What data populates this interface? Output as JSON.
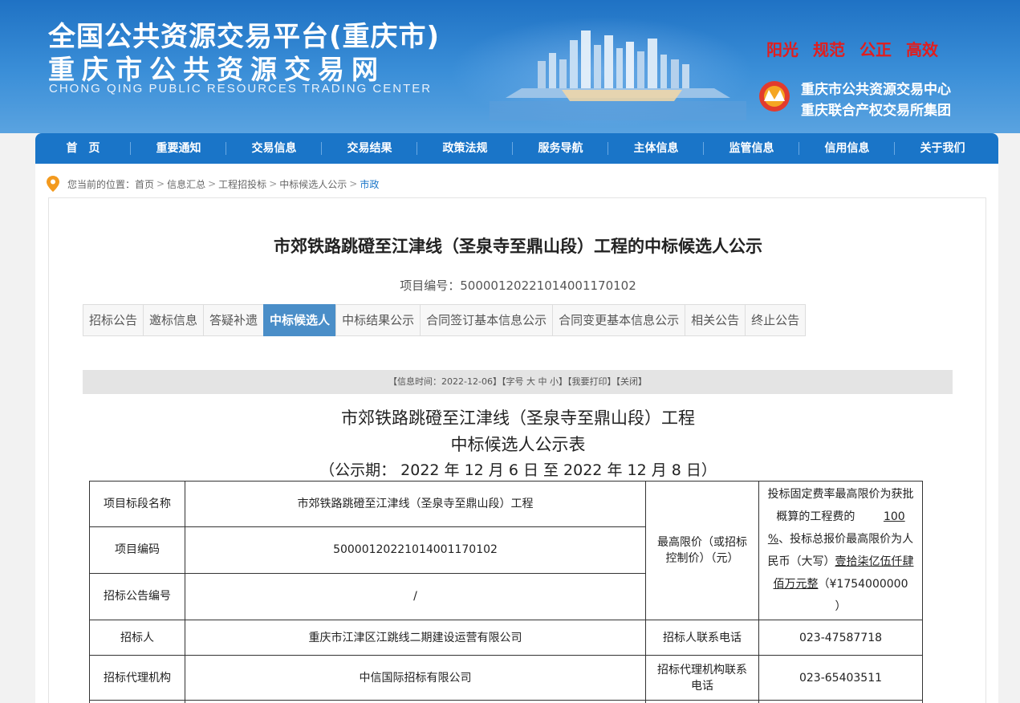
{
  "header": {
    "title_cn": "全国公共资源交易平台(重庆市)",
    "title_site": "重庆市公共资源交易网",
    "title_en": "CHONG QING PUBLIC RESOURCES TRADING CENTER",
    "slogans": [
      "阳光",
      "规范",
      "公正",
      "高效"
    ],
    "center_name1": "重庆市公共资源交易中心",
    "center_name2": "重庆联合产权交易所集团"
  },
  "nav": [
    "首　页",
    "重要通知",
    "交易信息",
    "交易结果",
    "政策法规",
    "服务导航",
    "主体信息",
    "监管信息",
    "信用信息",
    "关于我们"
  ],
  "breadcrumb": {
    "prefix": "您当前的位置：",
    "items": [
      "首页",
      "信息汇总",
      "工程招投标",
      "中标候选人公示"
    ],
    "current": "市政",
    "sep": ">"
  },
  "doc": {
    "title": "市郊铁路跳磴至江津线（圣泉寺至鼎山段）工程的中标候选人公示",
    "code_label": "项目编号：",
    "code": "500001202210140011701​02"
  },
  "tabs": [
    "招标公告",
    "邀标信息",
    "答疑补遗",
    "中标候选人",
    "中标结果公示",
    "合同签订基本信息公示",
    "合同变更基本信息公示",
    "相关公告",
    "终止公告"
  ],
  "active_tab": "中标候选人",
  "infobar": "【信息时间：2022-12-06】【字号 大 中 小】【我要打印】【关闭】",
  "sheet": {
    "title1": "市郊铁路跳磴至江津线（圣泉寺至鼎山段）工程",
    "title2": "中标候选人公示表",
    "period": "（公示期： 2022 年 12 月 6 日 至 2022 年 12 月 8 日）"
  },
  "table": {
    "r1_label": "项目标段名称",
    "r1_value": "市郊铁路跳磴至江津线（圣泉寺至鼎山段）工程",
    "r2_label": "项目编码",
    "r2_value": "500001202210140011701​02",
    "r3_label": "招标公告编号",
    "r3_value": "/",
    "max_label": "最高限价（或招标控制价）（元）",
    "max_value_a": "投标固定费率最高限价为获批概算的工程费的",
    "max_value_pct": "100",
    "max_value_pct_unit": "%",
    "max_value_b": "、投标总报价最高限价为人民币（大写）",
    "max_value_big": "壹拾柒亿伍仟肆佰万元整",
    "max_value_c": "（¥1754000000",
    "max_value_d": "）",
    "r4_label": "招标人",
    "r4_value": "重庆市江津区江跳线二期建设运营有限公司",
    "r4_contact_label": "招标人联系电话",
    "r4_contact": "023-47587718",
    "r5_label": "招标代理机构",
    "r5_value": "中信国际招标有限公司",
    "r5_contact_label": "招标代理机构联系电话",
    "r5_contact": "023-65403511"
  },
  "colors": {
    "nav_bg": "#1a75c8",
    "active_tab": "#4a8ec8",
    "slogan": "#e21d1d"
  }
}
